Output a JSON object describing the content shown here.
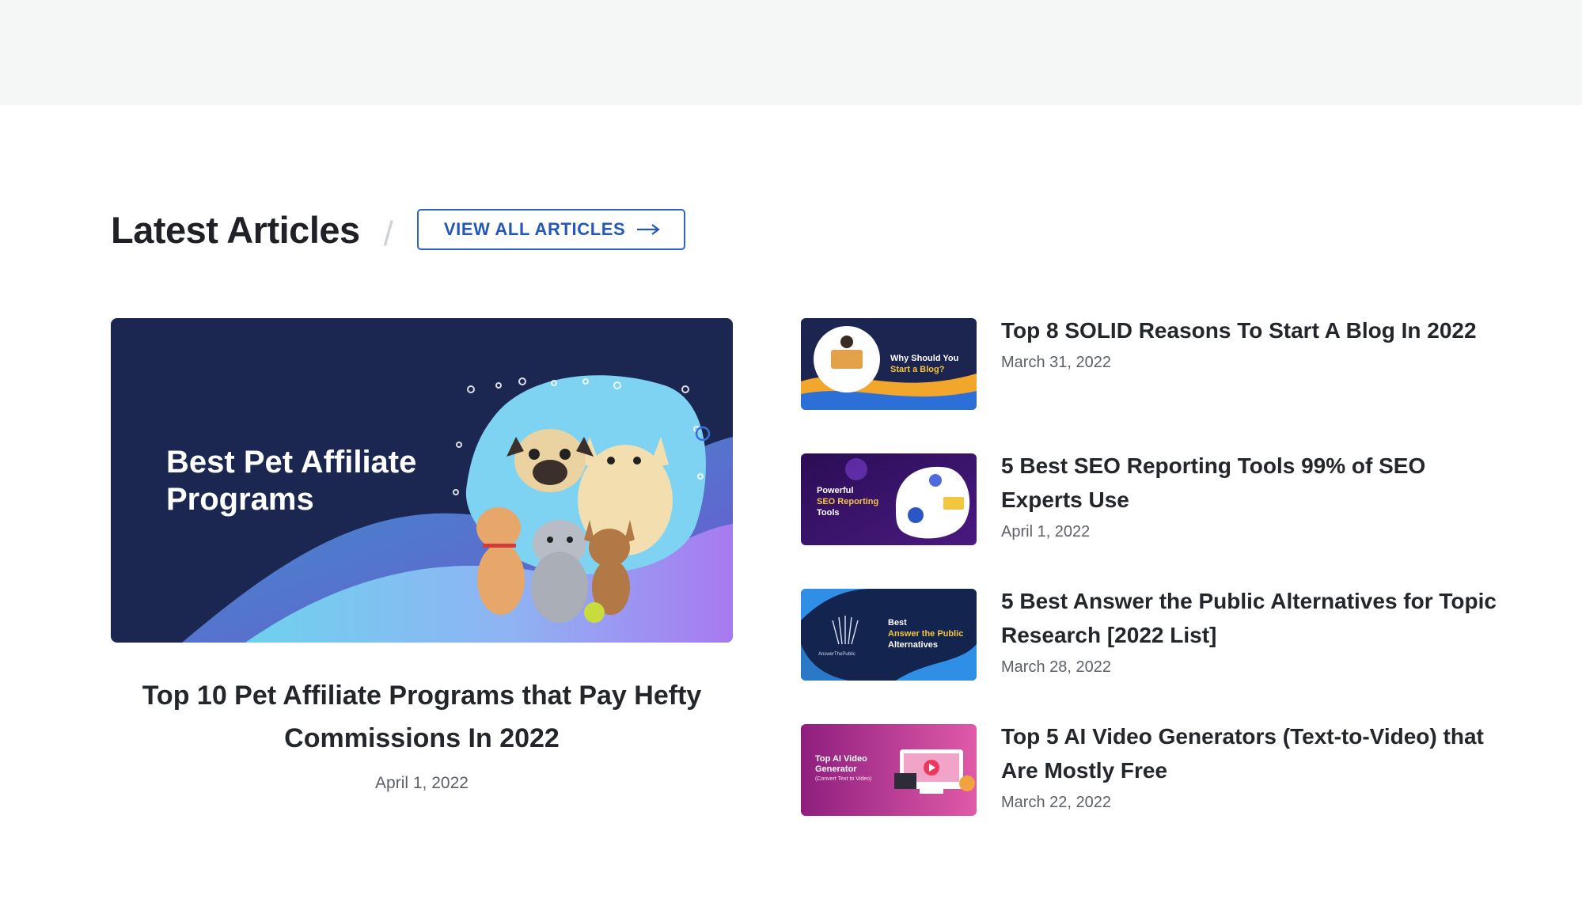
{
  "section": {
    "title": "Latest Articles",
    "divider": "/",
    "view_all_label": "VIEW ALL ARTICLES"
  },
  "featured": {
    "image_text_line1": "Best Pet Affiliate",
    "image_text_line2": "Programs",
    "title": "Top 10 Pet Affiliate Programs that Pay Hefty Commissions In 2022",
    "date": "April 1, 2022"
  },
  "articles": [
    {
      "title": "Top 8 SOLID Reasons To Start A Blog In 2022",
      "date": "March 31, 2022",
      "thumb_text": [
        "Why Should You",
        "Start a Blog?"
      ]
    },
    {
      "title": "5 Best SEO Reporting Tools 99% of SEO Experts Use",
      "date": "April 1, 2022",
      "thumb_text": [
        "Powerful",
        "SEO Reporting",
        "Tools"
      ]
    },
    {
      "title": "5 Best Answer the Public Alternatives for Topic Research [2022 List]",
      "date": "March 28, 2022",
      "thumb_text": [
        "Best",
        "Answer the Public",
        "Alternatives",
        "AnswerThePublic"
      ]
    },
    {
      "title": "Top 5 AI Video Generators (Text-to-Video) that Are Mostly Free",
      "date": "March 22, 2022",
      "thumb_text": [
        "Top AI Video",
        "Generator",
        "(Convert Text to Video)"
      ]
    }
  ],
  "colors": {
    "accent": "#2e63c6",
    "top_band": "#f5f7f7",
    "text_dark": "#23262b",
    "text_muted": "#5c6067"
  },
  "icons": {
    "view_all": "arrow-right-icon"
  }
}
